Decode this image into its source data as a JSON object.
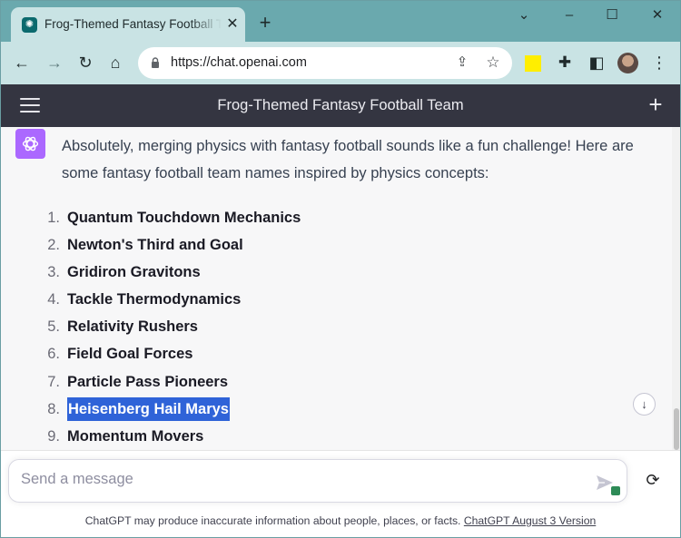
{
  "browser": {
    "tab": {
      "title": "Frog-Themed Fantasy Football Team",
      "favicon": "openai-favicon-icon"
    },
    "window_controls": [
      "minimize-icon",
      "maximize-icon",
      "close-icon"
    ],
    "address_bar": {
      "url": "https://chat.openai.com"
    },
    "colors": {
      "tabstrip": "#6aa9ae",
      "toolbar": "#c9e3e4"
    }
  },
  "header": {
    "title": "Frog-Themed Fantasy Football Team",
    "background": "#343541"
  },
  "conversation": {
    "intro": "Absolutely, merging physics with fantasy football sounds like a fun challenge! Here are some fantasy football team names inspired by physics concepts:",
    "items": [
      {
        "num": "1.",
        "text": "Quantum Touchdown Mechanics",
        "selected": false
      },
      {
        "num": "2.",
        "text": "Newton's Third and Goal",
        "selected": false
      },
      {
        "num": "3.",
        "text": "Gridiron Gravitons",
        "selected": false
      },
      {
        "num": "4.",
        "text": "Tackle Thermodynamics",
        "selected": false
      },
      {
        "num": "5.",
        "text": "Relativity Rushers",
        "selected": false
      },
      {
        "num": "6.",
        "text": "Field Goal Forces",
        "selected": false
      },
      {
        "num": "7.",
        "text": "Particle Pass Pioneers",
        "selected": false
      },
      {
        "num": "8.",
        "text": "Heisenberg Hail Marys",
        "selected": true
      },
      {
        "num": "9.",
        "text": "Momentum Movers",
        "selected": false
      }
    ],
    "selection_color": "#2f63d8",
    "avatar_color": "#ab68ff"
  },
  "composer": {
    "placeholder": "Send a message",
    "value": ""
  },
  "footer": {
    "note": "ChatGPT may produce inaccurate information about people, places, or facts.",
    "link": "ChatGPT August 3 Version"
  }
}
